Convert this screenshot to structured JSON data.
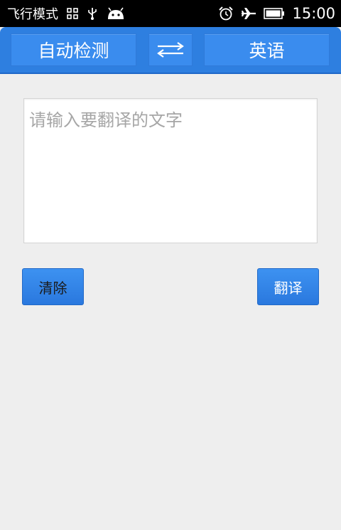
{
  "status_bar": {
    "mode_text": "飞行模式",
    "time": "15:00",
    "icons": [
      "grid-icon",
      "usb-icon",
      "android-icon",
      "alarm-icon",
      "airplane-icon",
      "battery-icon"
    ]
  },
  "toolbar": {
    "source_language": "自动检测",
    "swap_icon": "swap-arrows-icon",
    "target_language": "英语"
  },
  "input": {
    "placeholder": "请输入要翻译的文字",
    "value": ""
  },
  "actions": {
    "clear_label": "清除",
    "translate_label": "翻译"
  },
  "colors": {
    "accent": "#2e7fe0",
    "button": "#3a8cee",
    "background": "#eeeeee"
  }
}
